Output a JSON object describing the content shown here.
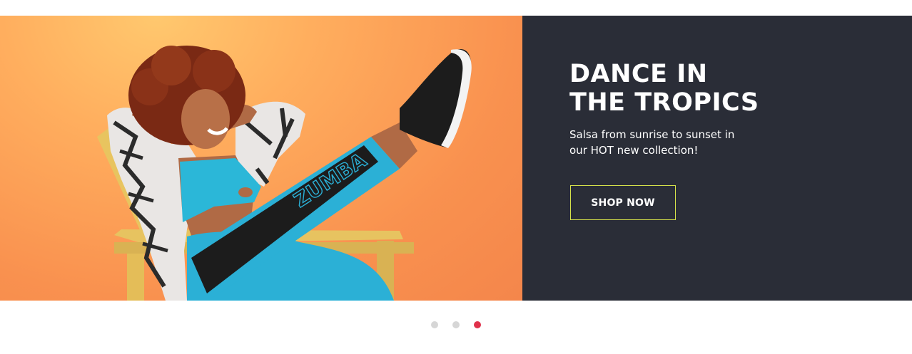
{
  "banner": {
    "image": {
      "alt": "Woman in Zumba outfit lounging on a yellow chair with one leg raised",
      "leggings_text": "ZUMBA",
      "background_color": "#f9914f"
    },
    "headline_line1": "DANCE IN",
    "headline_line2": "THE TROPICS",
    "subtext": "Salsa from sunrise to sunset in our HOT new collection!",
    "cta_label": "SHOP NOW",
    "panel_color": "#2a2d37",
    "cta_border_color": "#d6e24a"
  },
  "carousel": {
    "slides": 3,
    "active_index": 2,
    "dot_color": "#d6d6d6",
    "active_dot_color": "#e0314b"
  }
}
